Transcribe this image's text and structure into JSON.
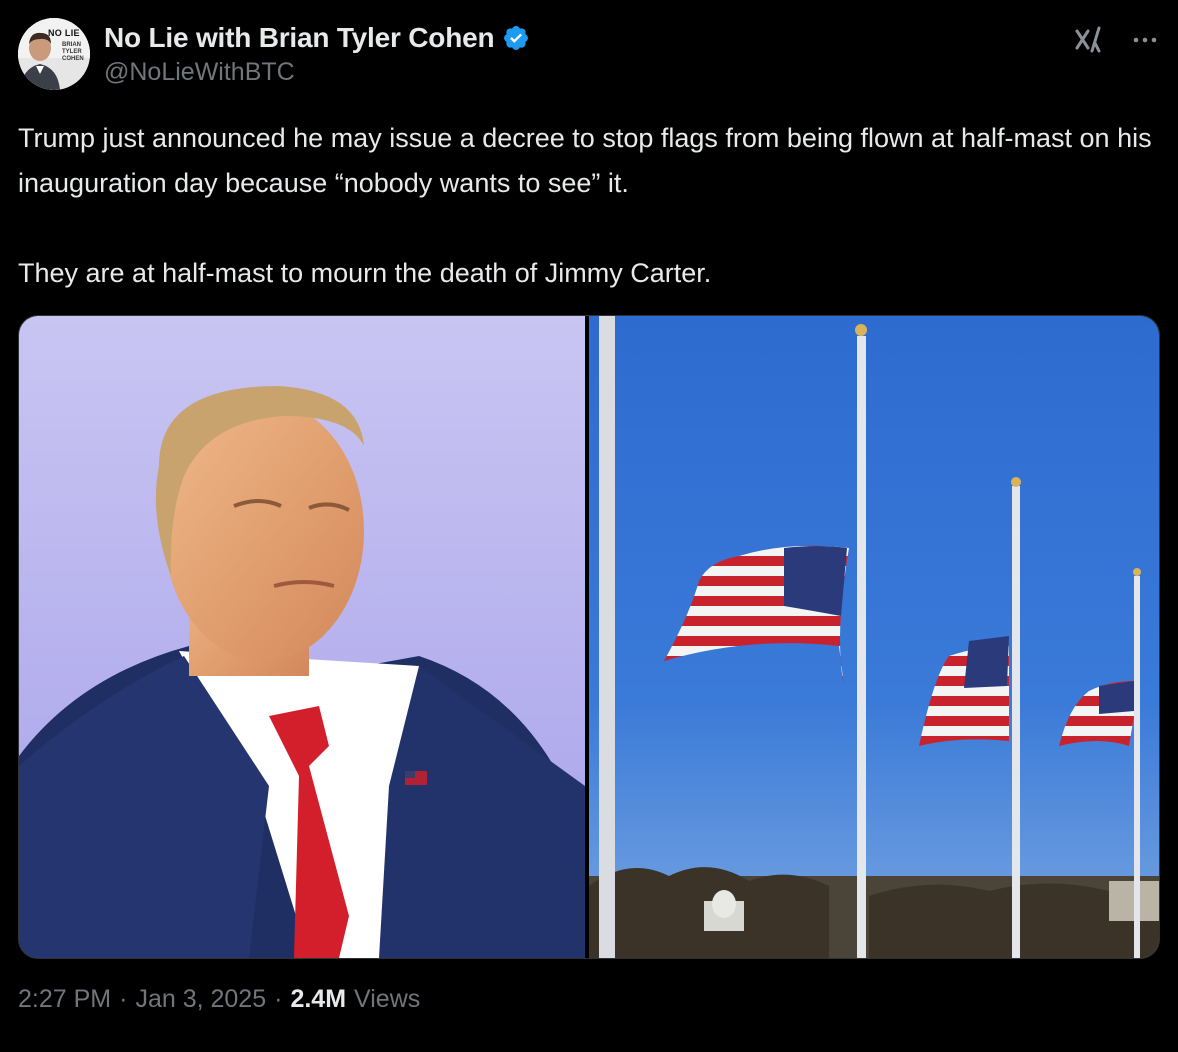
{
  "author": {
    "display_name": "No Lie with Brian Tyler Cohen",
    "handle": "@NoLieWithBTC",
    "avatar_badge": "NO LIE",
    "avatar_sub": "BRIAN TYLER COHEN"
  },
  "tweet": {
    "paragraphs": [
      "Trump just announced he may issue a decree to stop flags from being flown at half-mast on his inauguration day because “nobody wants to see” it.",
      "They are at half-mast to mourn the death of Jimmy Carter."
    ]
  },
  "meta": {
    "time": "2:27 PM",
    "separator": "·",
    "date": "Jan 3, 2025",
    "views_count": "2.4M",
    "views_label": "Views"
  },
  "icons": {
    "verified": "verified-badge-icon",
    "grok": "grok-icon",
    "more": "more-options-icon"
  },
  "colors": {
    "background": "#000000",
    "text_primary": "#e7e9ea",
    "text_secondary": "#71767b",
    "verified_blue": "#1d9bf0"
  }
}
